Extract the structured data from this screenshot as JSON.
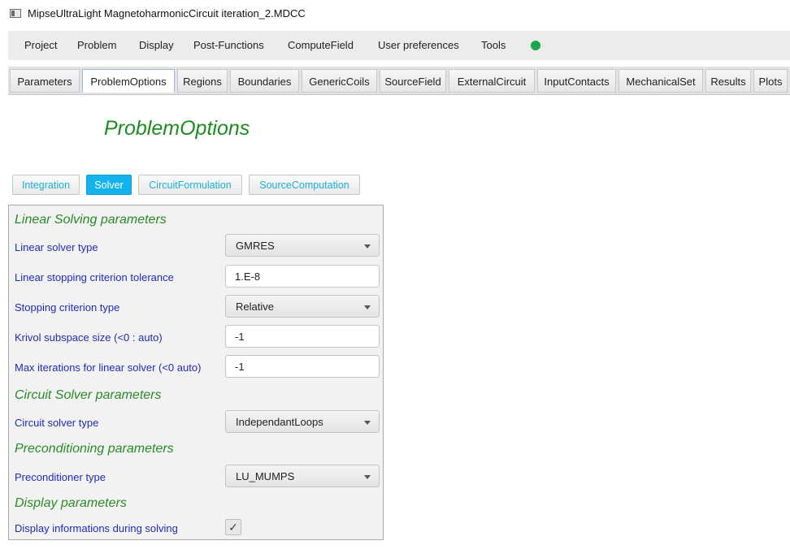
{
  "window": {
    "title": "MipseUltraLight MagnetoharmonicCircuit iteration_2.MDCC"
  },
  "menu": {
    "items": [
      "Project",
      "Problem",
      "Display",
      "Post-Functions",
      "ComputeField",
      "User preferences",
      "Tools"
    ],
    "status_color": "#1fa64a"
  },
  "tabs": {
    "items": [
      "Parameters",
      "ProblemOptions",
      "Regions",
      "Boundaries",
      "GenericCoils",
      "SourceField",
      "ExternalCircuit",
      "InputContacts",
      "MechanicalSet",
      "Results",
      "Plots"
    ],
    "active": "ProblemOptions"
  },
  "page": {
    "title": "ProblemOptions"
  },
  "subtabs": {
    "items": [
      "Integration",
      "Solver",
      "CircuitFormulation",
      "SourceComputation"
    ],
    "active": "Solver"
  },
  "panel": {
    "sections": {
      "linear": "Linear Solving parameters",
      "circuit": "Circuit Solver parameters",
      "precond": "Preconditioning parameters",
      "display": "Display parameters"
    },
    "linear_solver_type": {
      "label": "Linear solver type",
      "value": "GMRES"
    },
    "tolerance": {
      "label": "Linear stopping criterion tolerance",
      "value": "1.E-8"
    },
    "criterion_type": {
      "label": "Stopping criterion type",
      "value": "Relative"
    },
    "krylov": {
      "label": "Krivol subspace size (<0 : auto)",
      "value": "-1"
    },
    "max_iter": {
      "label": "Max iterations for linear solver (<0 auto)",
      "value": "-1"
    },
    "circuit_solver_type": {
      "label": "Circuit solver type",
      "value": "IndependantLoops"
    },
    "preconditioner_type": {
      "label": "Preconditioner type",
      "value": "LU_MUMPS"
    },
    "display_info": {
      "label": "Display informations during solving",
      "checked": true,
      "check_glyph": "✓"
    }
  }
}
